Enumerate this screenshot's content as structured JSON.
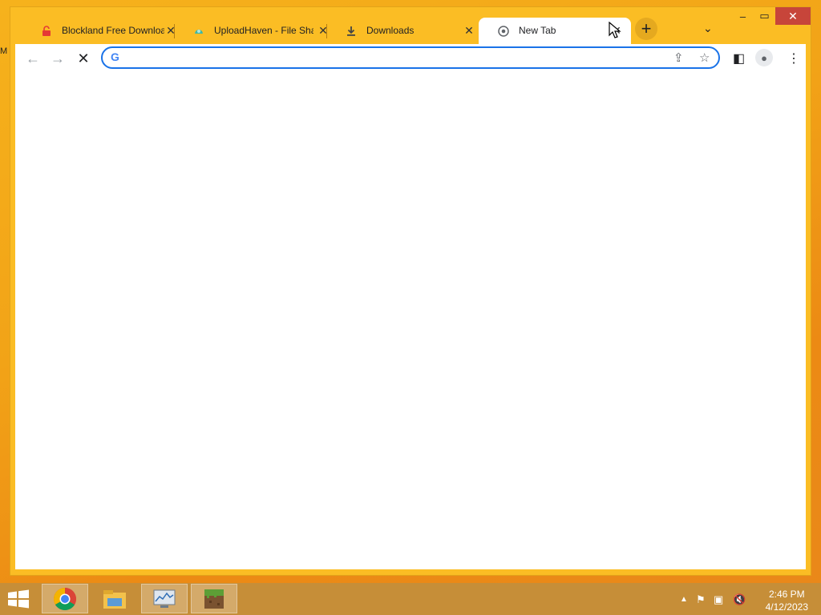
{
  "desktop": {
    "sliver_text": "M"
  },
  "tabs": [
    {
      "title": "Blockland Free Downloa",
      "favicon": "red-lock-icon"
    },
    {
      "title": "UploadHaven - File Sha",
      "favicon": "uploadhaven-icon"
    },
    {
      "title": "Downloads",
      "favicon": "download-icon"
    },
    {
      "title": "New Tab",
      "favicon": "chrome-icon"
    }
  ],
  "toolbar": {
    "omnibox_value": "",
    "omnibox_engine": "G"
  },
  "taskbar": {
    "apps": [
      "chrome",
      "file-explorer",
      "performance-monitor",
      "minecraft"
    ],
    "time": "2:46 PM",
    "date": "4/12/2023"
  },
  "colors": {
    "accent": "#1a73e8",
    "tabstrip": "#fbbd24",
    "close_button": "#c7453a"
  }
}
